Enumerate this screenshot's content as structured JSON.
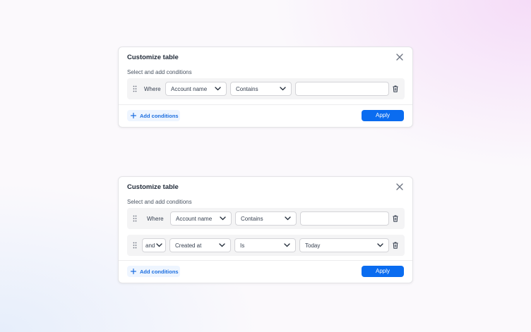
{
  "panels": [
    {
      "title": "Customize table",
      "subtitle": "Select and add conditions",
      "conditions": [
        {
          "connector": "Where",
          "field": "Account name",
          "operator": "Contains",
          "value": ""
        }
      ],
      "add_label": "Add conditions",
      "apply_label": "Apply"
    },
    {
      "title": "Customize table",
      "subtitle": "Select and add conditions",
      "conditions": [
        {
          "connector": "Where",
          "field": "Account name",
          "operator": "Contains",
          "value": ""
        },
        {
          "connector": "and",
          "field": "Created at",
          "operator": "Is",
          "value": "Today"
        }
      ],
      "add_label": "Add conditions",
      "apply_label": "Apply"
    }
  ],
  "icons": {
    "close": "close-icon",
    "drag": "drag-handle-icon",
    "chevron": "chevron-down-icon",
    "trash": "trash-icon",
    "plus": "plus-icon"
  },
  "colors": {
    "primary": "#0a6cf0",
    "add_bg": "#eef5ff",
    "add_text": "#1d6fe0",
    "row_bg": "#f4f4f5",
    "border": "#d4d4d8"
  }
}
